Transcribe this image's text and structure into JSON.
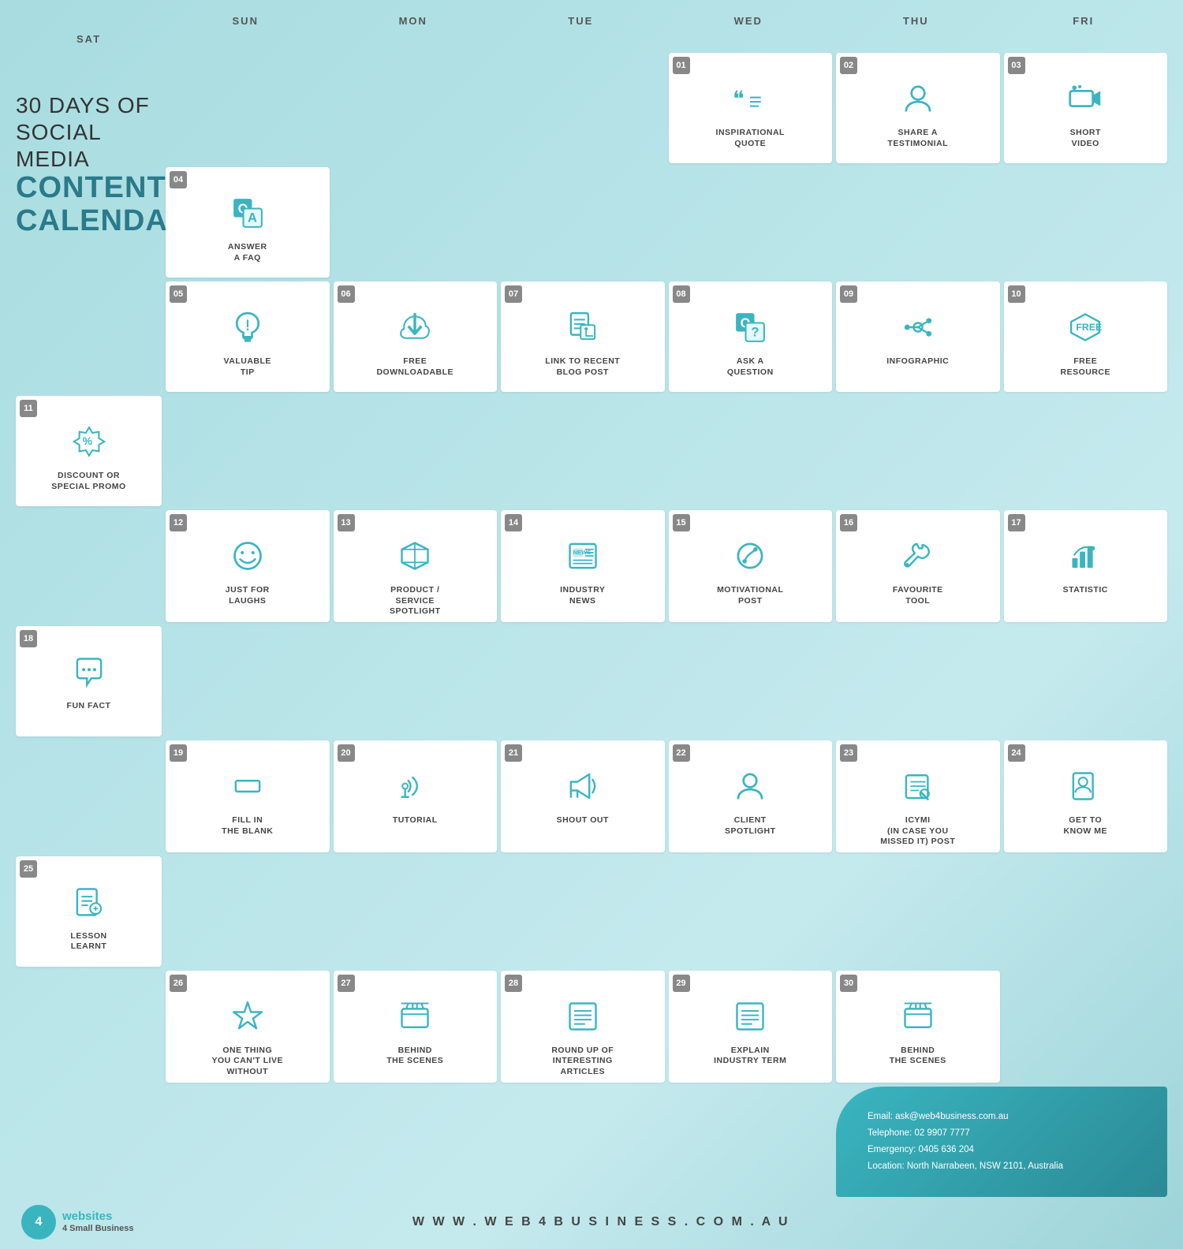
{
  "title": {
    "line1": "30 DAYS OF SOCIAL MEDIA",
    "line2": "CONTENT CALENDAR"
  },
  "days": [
    "SUN",
    "MON",
    "TUE",
    "WED",
    "THU",
    "FRI",
    "SAT"
  ],
  "cells": [
    {
      "num": "01",
      "label": "INSPIRATIONAL\nQUOTE",
      "icon": "quote"
    },
    {
      "num": "02",
      "label": "SHARE A\nTESTIMONIAL",
      "icon": "testimonial"
    },
    {
      "num": "03",
      "label": "SHORT\nVIDEO",
      "icon": "video"
    },
    {
      "num": "04",
      "label": "ANSWER\nA FAQ",
      "icon": "faq"
    },
    {
      "num": "05",
      "label": "VALUABLE\nTIP",
      "icon": "tip"
    },
    {
      "num": "06",
      "label": "FREE\nDOWNLOADABLE",
      "icon": "download"
    },
    {
      "num": "07",
      "label": "LINK TO RECENT\nBLOG POST",
      "icon": "blog"
    },
    {
      "num": "08",
      "label": "ASK A\nQUESTION",
      "icon": "question"
    },
    {
      "num": "09",
      "label": "INFOGRAPHIC",
      "icon": "infographic"
    },
    {
      "num": "10",
      "label": "FREE\nRESOURCE",
      "icon": "free"
    },
    {
      "num": "11",
      "label": "DISCOUNT OR\nSPECIAL PROMO",
      "icon": "discount"
    },
    {
      "num": "12",
      "label": "JUST FOR\nLAUGHS",
      "icon": "laugh"
    },
    {
      "num": "13",
      "label": "PRODUCT /\nSERVICE\nSPOTLIGHT",
      "icon": "product"
    },
    {
      "num": "14",
      "label": "INDUSTRY\nNEWS",
      "icon": "news"
    },
    {
      "num": "15",
      "label": "MOTIVATIONAL\nPOST",
      "icon": "motivational"
    },
    {
      "num": "16",
      "label": "FAVOURITE\nTOOL",
      "icon": "tool"
    },
    {
      "num": "17",
      "label": "STATISTIC",
      "icon": "statistic"
    },
    {
      "num": "18",
      "label": "FUN FACT",
      "icon": "funfact"
    },
    {
      "num": "19",
      "label": "FILL IN\nTHE BLANK",
      "icon": "blank"
    },
    {
      "num": "20",
      "label": "TUTORIAL",
      "icon": "tutorial"
    },
    {
      "num": "21",
      "label": "SHOUT OUT",
      "icon": "shoutout"
    },
    {
      "num": "22",
      "label": "CLIENT\nSPOTLIGHT",
      "icon": "client"
    },
    {
      "num": "23",
      "label": "ICYMI\n(IN CASE YOU\nMISSED IT) POST",
      "icon": "icymi"
    },
    {
      "num": "24",
      "label": "GET TO\nKNOW ME",
      "icon": "knowme"
    },
    {
      "num": "25",
      "label": "LESSON\nLEARNT",
      "icon": "lesson"
    },
    {
      "num": "26",
      "label": "ONE THING\nYOU CAN'T LIVE\nWITHOUT",
      "icon": "star"
    },
    {
      "num": "27",
      "label": "BEHIND\nTHE SCENES",
      "icon": "scenes"
    },
    {
      "num": "28",
      "label": "ROUND UP OF\nINTERESTING\nARTICLES",
      "icon": "roundup"
    },
    {
      "num": "29",
      "label": "EXPLAIN\nINDUSTRY TERM",
      "icon": "explain"
    },
    {
      "num": "30",
      "label": "BEHIND\nTHE SCENES",
      "icon": "scenes"
    }
  ],
  "contact": {
    "email": "Email: ask@web4business.com.au",
    "telephone": "Telephone: 02 9907 7777",
    "emergency": "Emergency: 0405 636 204",
    "location": "Location:  North Narrabeen, NSW 2101, Australia"
  },
  "footer": {
    "logo_text1": "websites",
    "logo_text2": "4 Small Business",
    "url": "W W W . W E B 4 B U S I N E S S . C O M . A U"
  }
}
